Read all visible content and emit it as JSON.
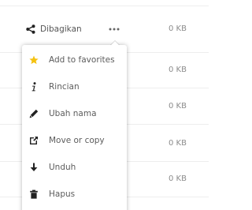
{
  "file_row": {
    "share_label": "Dibagikan"
  },
  "sizes": [
    "0 KB",
    "0 KB",
    "0 KB",
    "0 KB",
    "0 KB"
  ],
  "menu": {
    "items": [
      {
        "label": "Add to favorites",
        "icon": "star-icon"
      },
      {
        "label": "Rincian",
        "icon": "info-icon"
      },
      {
        "label": "Ubah nama",
        "icon": "pencil-icon"
      },
      {
        "label": "Move or copy",
        "icon": "external-link-icon"
      },
      {
        "label": "Unduh",
        "icon": "download-icon"
      },
      {
        "label": "Hapus",
        "icon": "trash-icon"
      }
    ]
  },
  "colors": {
    "star": "#f5c211",
    "icon_dark": "#222222",
    "text": "#5c5c5c",
    "divider": "#ededed"
  }
}
